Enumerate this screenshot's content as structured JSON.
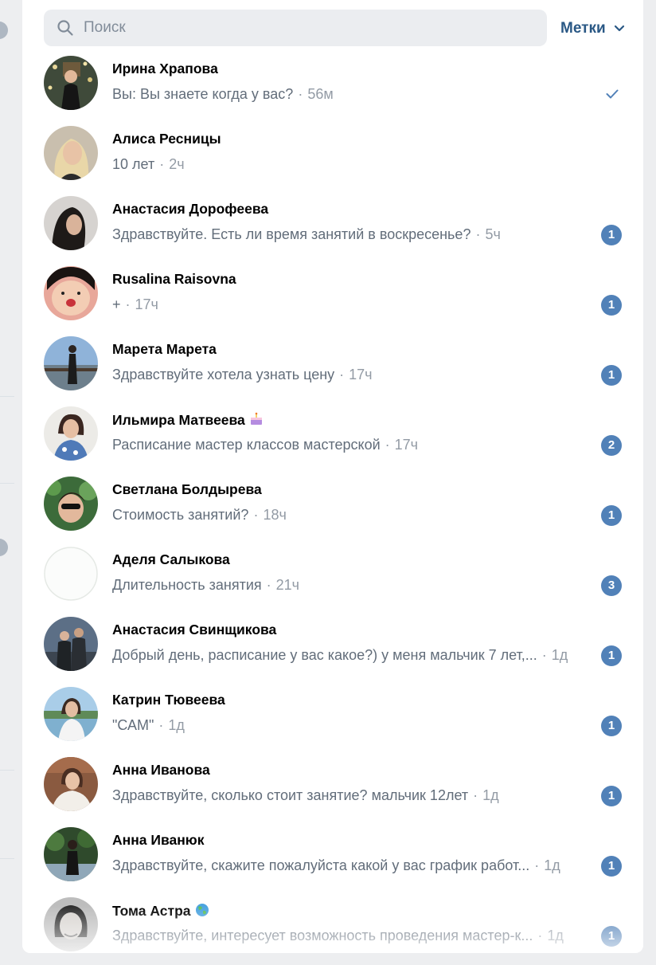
{
  "search": {
    "placeholder": "Поиск",
    "value": ""
  },
  "labels_button": {
    "label": "Метки"
  },
  "colors": {
    "accent": "#2a5885",
    "badge": "#5181b8",
    "muted": "#939ba5"
  },
  "dialogs": [
    {
      "name": "Ирина Храпова",
      "message": "Вы: Вы знаете когда у вас?",
      "time": "56м",
      "unread": "",
      "read": true
    },
    {
      "name": "Алиса Ресницы",
      "message": "10 лет",
      "time": "2ч",
      "unread": "",
      "read": false
    },
    {
      "name": "Анастасия Дорофеева",
      "message": "Здравствуйте. Есть ли время занятий в воскресенье?",
      "time": "5ч",
      "unread": "1",
      "read": false
    },
    {
      "name": "Rusalina Raisovna",
      "message": "+",
      "time": "17ч",
      "unread": "1",
      "read": false
    },
    {
      "name": "Марета Марета",
      "message": "Здравствуйте хотела узнать цену",
      "time": "17ч",
      "unread": "1",
      "read": false
    },
    {
      "name": "Ильмира Матвеева",
      "message": "Расписание мастер классов мастерской",
      "time": "17ч",
      "unread": "2",
      "read": false,
      "emoji": "cake-emoji"
    },
    {
      "name": "Светлана Болдырева",
      "message": "Стоимость занятий?",
      "time": "18ч",
      "unread": "1",
      "read": false
    },
    {
      "name": "Аделя Салыкова",
      "message": "Длительность занятия",
      "time": "21ч",
      "unread": "3",
      "read": false
    },
    {
      "name": "Анастасия Свинщикова",
      "message": "Добрый день, расписание у вас какое?) у меня мальчик 7 лет,...",
      "time": "1д",
      "unread": "1",
      "read": false
    },
    {
      "name": "Катрин Тювеева",
      "message": "\"САМ\"",
      "time": "1д",
      "unread": "1",
      "read": false
    },
    {
      "name": "Анна Иванова",
      "message": "Здравствуйте, сколько стоит занятие? мальчик 12лет",
      "time": "1д",
      "unread": "1",
      "read": false
    },
    {
      "name": "Анна Иванюк",
      "message": "Здравствуйте, скажите пожалуйста какой у вас график работ...",
      "time": "1д",
      "unread": "1",
      "read": false
    },
    {
      "name": "Тома Астра",
      "message": "Здравствуйте, интересует возможность проведения мастер-к...",
      "time": "1д",
      "unread": "1",
      "read": false,
      "emoji": "globe-emoji"
    }
  ]
}
